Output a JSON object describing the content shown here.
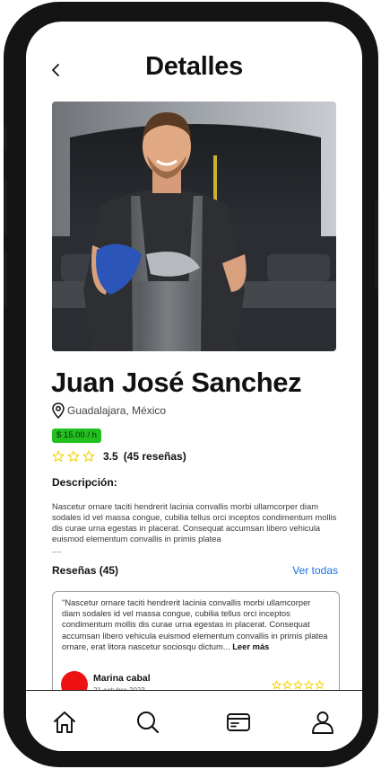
{
  "header": {
    "title": "Detalles"
  },
  "profile": {
    "name": "Juan José Sanchez",
    "location": "Guadalajara, México",
    "price": "$ 15.00 / h",
    "rating": {
      "value": "3.5",
      "count_label": "(45 reseñas)",
      "stars_total": 3
    }
  },
  "description": {
    "label": "Descripción:",
    "text": "Nascetur ornare taciti hendrerit lacinia convallis morbi ullamcorper diam sodales id vel massa congue, cubilia tellus orci inceptos condimentum mollis dis curae urna egestas in placerat. Consequat accumsan libero vehicula euismod elementum convallis in primis platea",
    "ellipsis": "...."
  },
  "reviews": {
    "label": "Reseñas (45)",
    "see_all": "Ver todas",
    "items": [
      {
        "text": "\"Nascetur ornare taciti hendrerit lacinia convallis morbi ullamcorper diam sodales id vel massa congue, cubilia tellus orci inceptos condimentum mollis dis curae urna egestas in placerat. Consequat accumsan libero vehicula euismod elementum convallis in primis platea ornare, erat litora nascetur sociosqu dictum...",
        "read_more": "Leer más",
        "author": "Marina cabal",
        "date": "21 octubre 2023",
        "stars": 5
      }
    ]
  },
  "tabbar": {
    "items": [
      "home-icon",
      "search-icon",
      "card-icon",
      "user-icon"
    ]
  },
  "colors": {
    "price_badge": "#22c01f",
    "link": "#1a6fe0",
    "avatar": "#ee1111",
    "star": "#f4d000"
  }
}
